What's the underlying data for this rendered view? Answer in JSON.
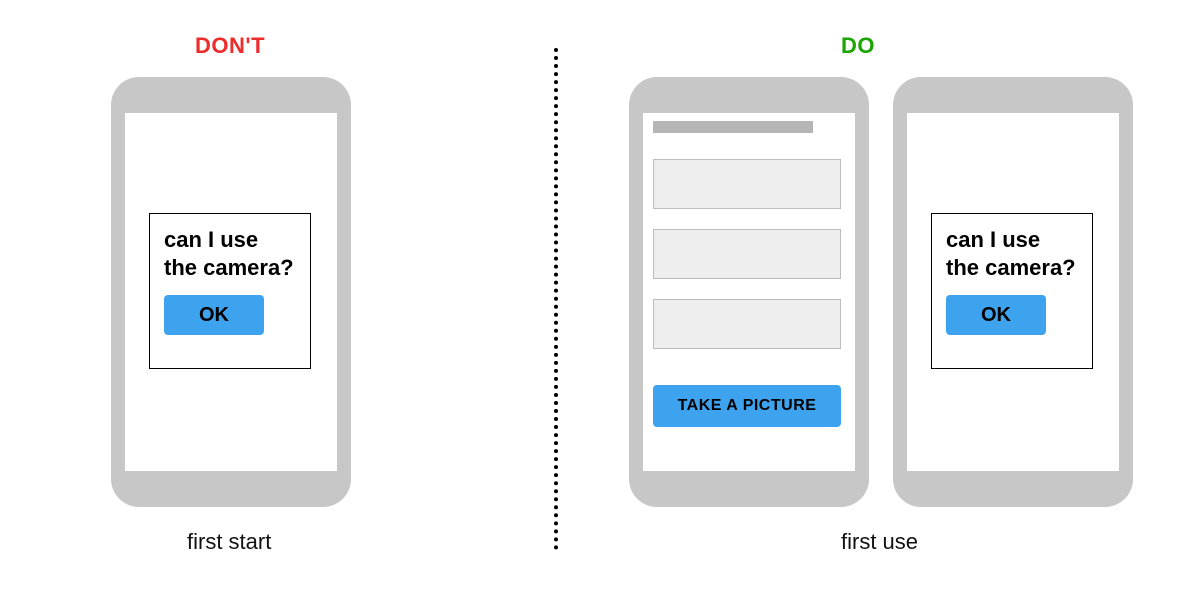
{
  "dont": {
    "label": "DON'T",
    "caption": "first start",
    "dialog": {
      "prompt": "can I use the camera?",
      "ok": "OK"
    }
  },
  "do": {
    "label": "DO",
    "caption": "first use",
    "form": {
      "cta": "TAKE A PICTURE"
    },
    "dialog": {
      "prompt": "can I use the camera?",
      "ok": "OK"
    }
  }
}
